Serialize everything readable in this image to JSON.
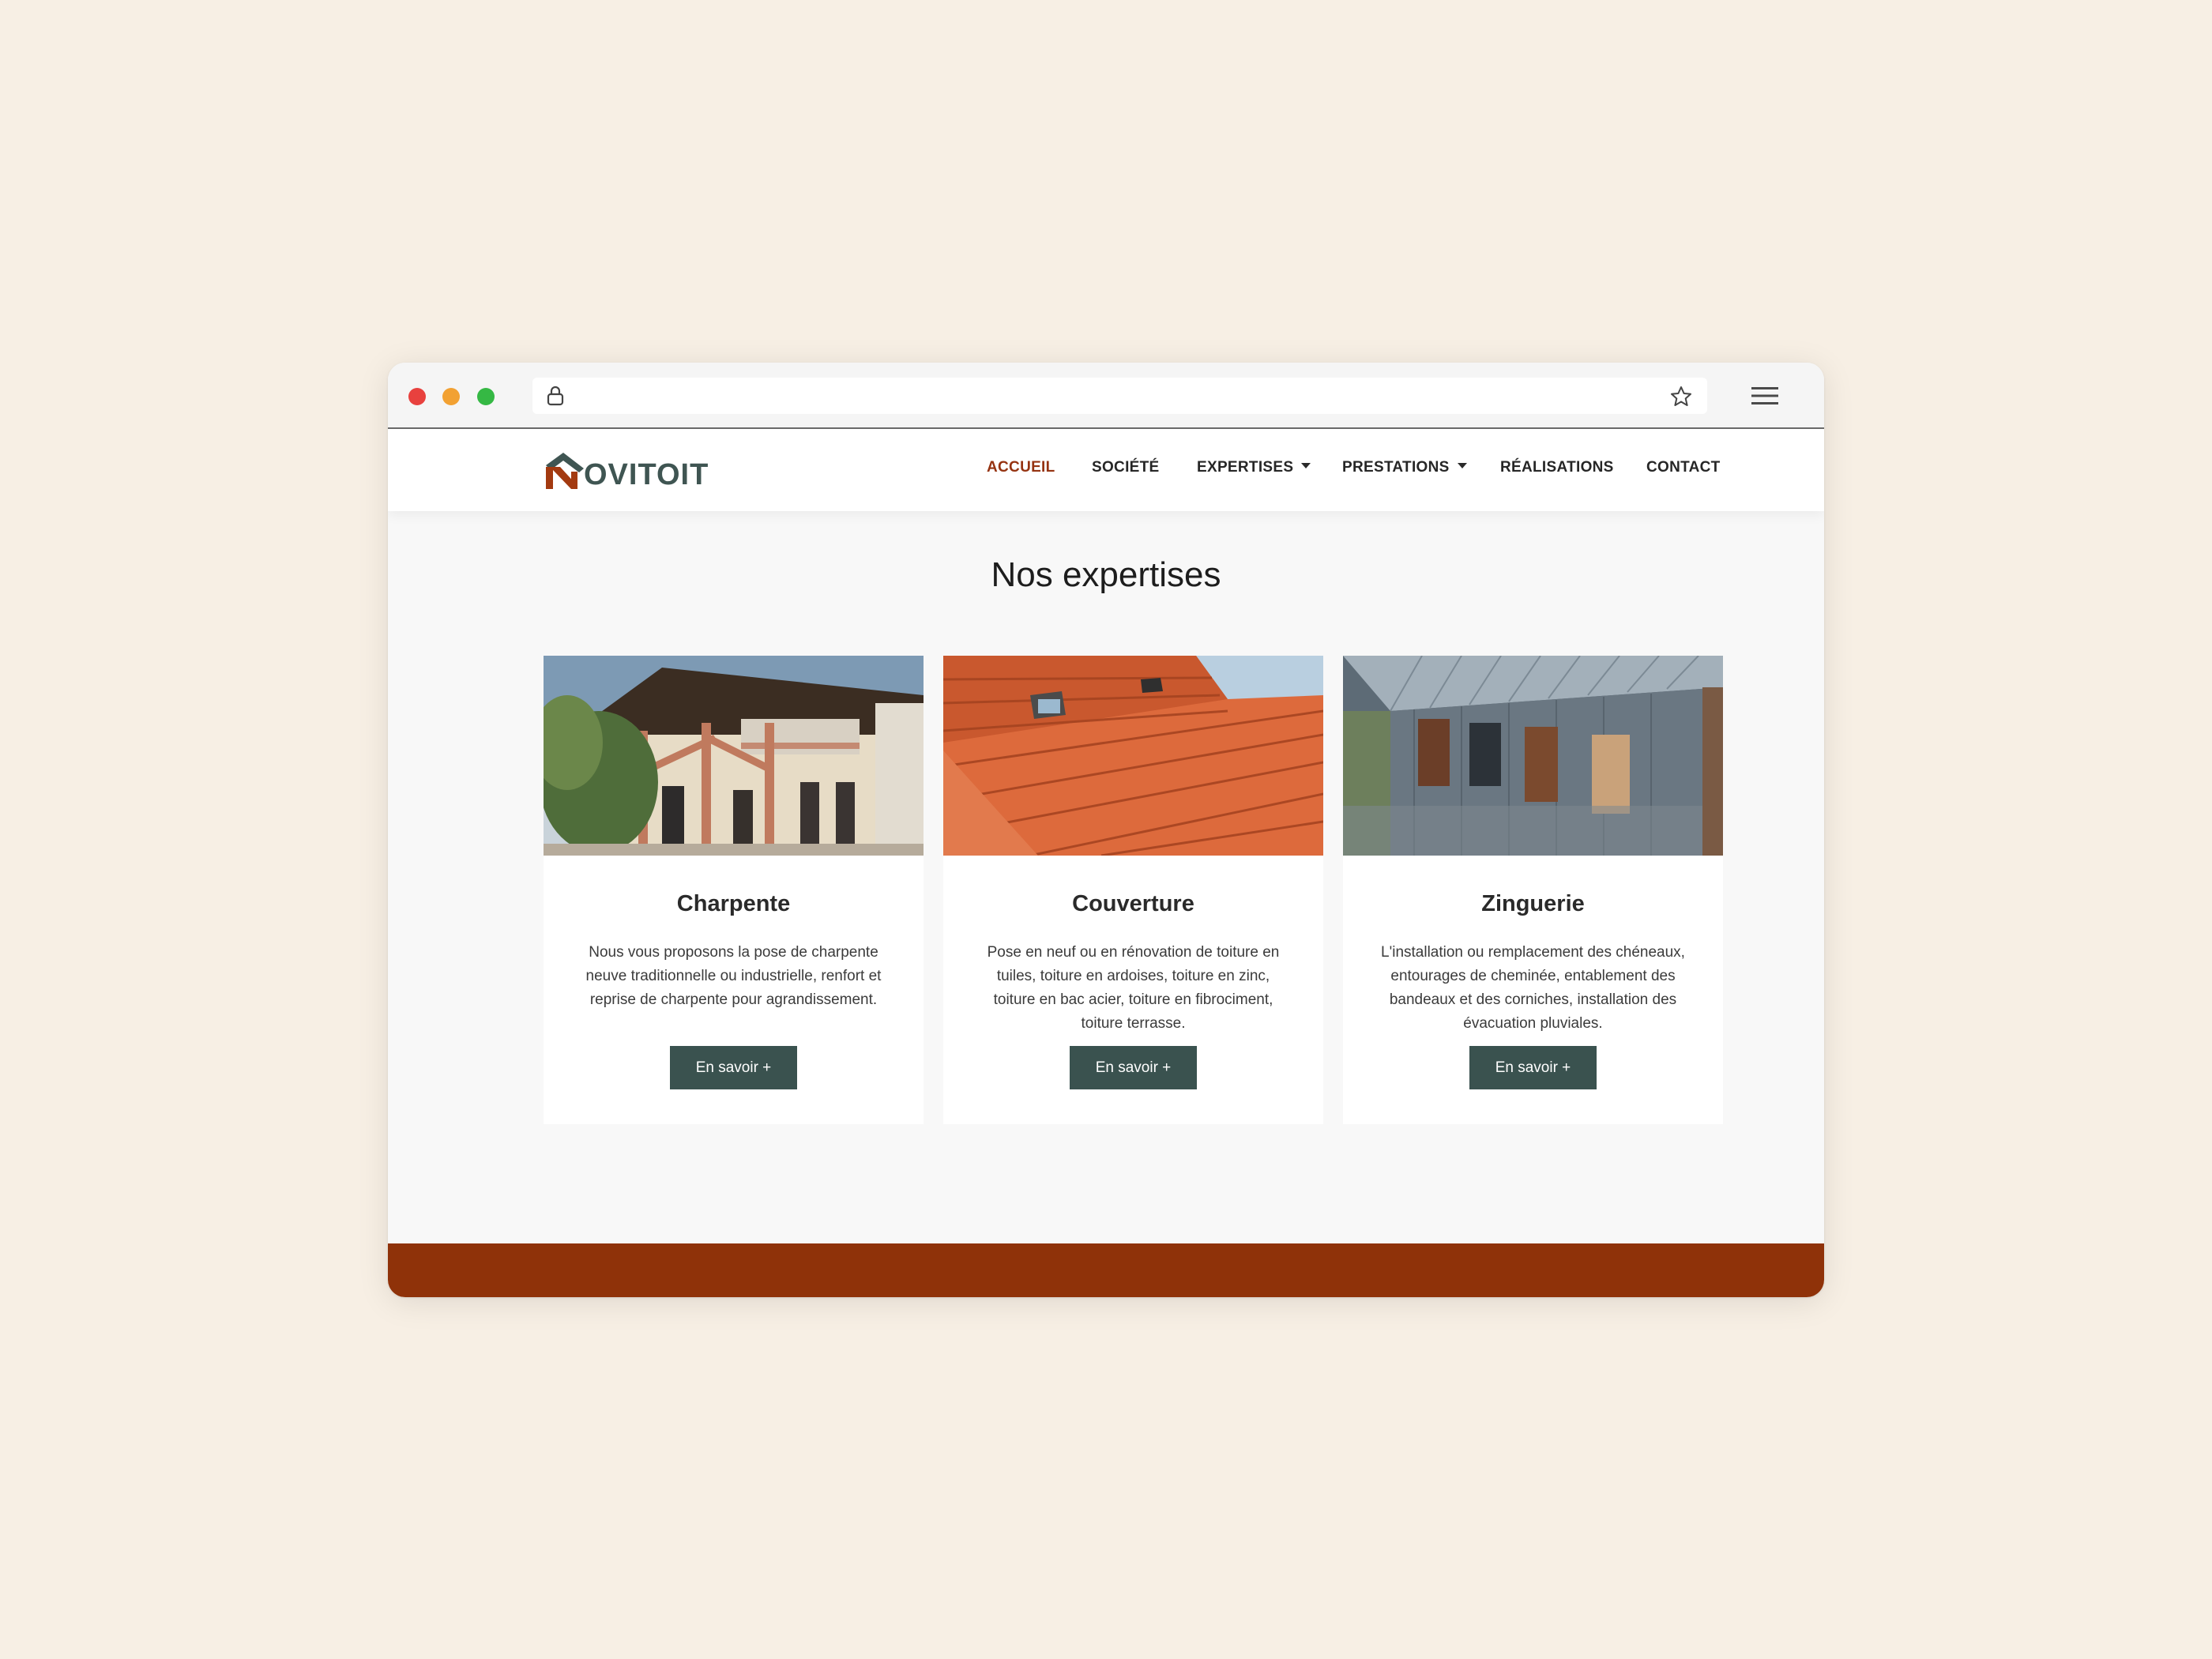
{
  "browser": {
    "url": "",
    "window_controls": [
      "close",
      "minimize",
      "maximize"
    ],
    "icons": [
      "lock-icon",
      "star-icon",
      "hamburger-menu-icon"
    ]
  },
  "site": {
    "logo_text": "OVITOIT",
    "logo_full": "NOVITOIT",
    "nav": {
      "accueil": "ACCUEIL",
      "societe": "SOCIÉTÉ",
      "expertises": "EXPERTISES",
      "prestations": "PRESTATIONS",
      "realisations": "RÉALISATIONS",
      "contact": "CONTACT"
    },
    "active_nav": "ACCUEIL"
  },
  "main": {
    "title": "Nos expertises",
    "cards": [
      {
        "title": "Charpente",
        "text": "Nous vous proposons la pose de charpente neuve traditionnelle ou industrielle, renfort et reprise de charpente pour agrandissement.",
        "button": "En savoir +",
        "image": "house-timber-frame-photo"
      },
      {
        "title": "Couverture",
        "text": "Pose en neuf ou en rénovation de toiture en tuiles, toiture en ardoises, toiture en zinc, toiture en bac acier, toiture en fibrociment, toiture terrasse.",
        "button": "En savoir +",
        "image": "terracotta-roof-tiles-photo"
      },
      {
        "title": "Zinguerie",
        "text": "L'installation ou remplacement des chéneaux, entourages de cheminée, entablement des bandeaux et des corniches, installation des évacuation pluviales.",
        "button": "En savoir +",
        "image": "zinc-clad-building-photo"
      }
    ]
  },
  "colors": {
    "page_background": "#f7efe4",
    "accent_rust": "#8f3209",
    "active_nav": "#953311",
    "button_dark_green": "#3a524f",
    "logo_green": "#3f5552"
  }
}
